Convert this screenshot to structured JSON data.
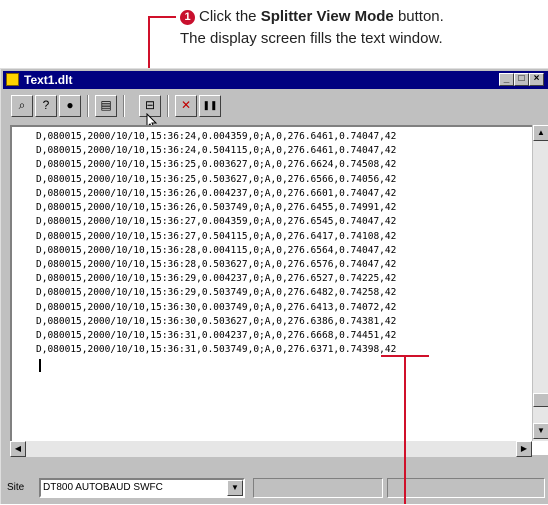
{
  "annotation": {
    "step_number": "1",
    "line1_before": "Click the ",
    "line1_bold": "Splitter View Mode",
    "line1_after": " button.",
    "line2": "The display screen fills the text window."
  },
  "window": {
    "title": "Text1.dlt"
  },
  "toolbar": {
    "buttons": [
      {
        "name": "find-icon",
        "glyph": "⌕"
      },
      {
        "name": "help-icon",
        "glyph": "?"
      },
      {
        "name": "record-icon",
        "glyph": "●"
      },
      {
        "name": "properties-icon",
        "glyph": "▤"
      },
      {
        "name": "splitter-view-icon",
        "glyph": "⊟"
      },
      {
        "name": "stop-icon",
        "glyph": "✕"
      },
      {
        "name": "pause-icon",
        "glyph": "❚❚"
      }
    ]
  },
  "text_lines": [
    "D,080015,2000/10/10,15:36:24,0.004359,0;A,0,276.6461,0.74047,42",
    "D,080015,2000/10/10,15:36:24,0.504115,0;A,0,276.6461,0.74047,42",
    "D,080015,2000/10/10,15:36:25,0.003627,0;A,0,276.6624,0.74508,42",
    "D,080015,2000/10/10,15:36:25,0.503627,0;A,0,276.6566,0.74056,42",
    "D,080015,2000/10/10,15:36:26,0.004237,0;A,0,276.6601,0.74047,42",
    "D,080015,2000/10/10,15:36:26,0.503749,0;A,0,276.6455,0.74991,42",
    "D,080015,2000/10/10,15:36:27,0.004359,0;A,0,276.6545,0.74047,42",
    "D,080015,2000/10/10,15:36:27,0.504115,0;A,0,276.6417,0.74108,42",
    "D,080015,2000/10/10,15:36:28,0.004115,0;A,0,276.6564,0.74047,42",
    "D,080015,2000/10/10,15:36:28,0.503627,0;A,0,276.6576,0.74047,42",
    "D,080015,2000/10/10,15:36:29,0.004237,0;A,0,276.6527,0.74225,42",
    "D,080015,2000/10/10,15:36:29,0.503749,0;A,0,276.6482,0.74258,42",
    "D,080015,2000/10/10,15:36:30,0.003749,0;A,0,276.6413,0.74072,42",
    "D,080015,2000/10/10,15:36:30,0.503627,0;A,0,276.6386,0.74381,42",
    "D,080015,2000/10/10,15:36:31,0.004237,0;A,0,276.6668,0.74451,42",
    "D,080015,2000/10/10,15:36:31,0.503749,0;A,0,276.6371,0.74398,42"
  ],
  "status": {
    "site_label": "Site",
    "site_value": "DT800 AUTOBAUD SWFC"
  }
}
